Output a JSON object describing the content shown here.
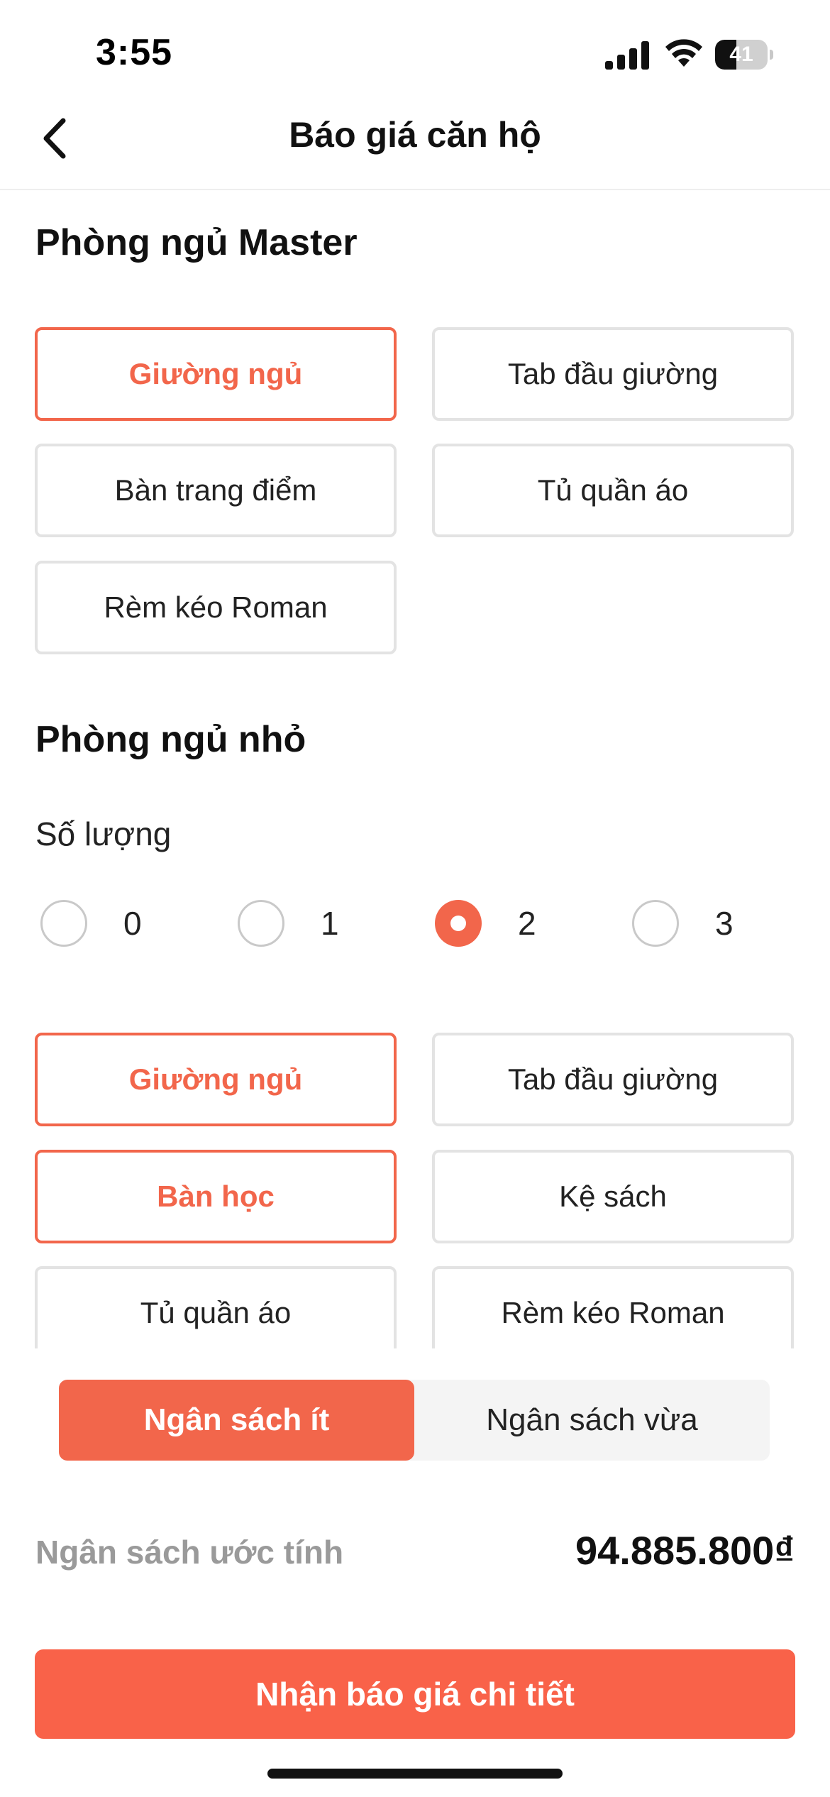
{
  "status_bar": {
    "time": "3:55",
    "battery": "41",
    "battery_level": 0.41
  },
  "header": {
    "title": "Báo giá căn hộ",
    "back_icon": "chevron-left-icon"
  },
  "master_bedroom": {
    "title": "Phòng ngủ Master",
    "items": [
      {
        "label": "Giường ngủ",
        "selected": true
      },
      {
        "label": "Tab đầu giường",
        "selected": false
      },
      {
        "label": "Bàn trang điểm",
        "selected": false
      },
      {
        "label": "Tủ quần áo",
        "selected": false
      },
      {
        "label": "Rèm kéo Roman",
        "selected": false
      }
    ]
  },
  "small_bedroom": {
    "title": "Phòng ngủ nhỏ",
    "quantity_label": "Số lượng",
    "quantity_options": [
      "0",
      "1",
      "2",
      "3"
    ],
    "quantity_selected": "2",
    "items": [
      {
        "label": "Giường ngủ",
        "selected": true
      },
      {
        "label": "Tab đầu giường",
        "selected": false
      },
      {
        "label": "Bàn học",
        "selected": true
      },
      {
        "label": "Kệ sách",
        "selected": false
      },
      {
        "label": "Tủ quần áo",
        "selected": false
      },
      {
        "label": "Rèm kéo Roman",
        "selected": false
      }
    ]
  },
  "budget": {
    "options": [
      {
        "label": "Ngân sách ít",
        "active": true
      },
      {
        "label": "Ngân sách vừa",
        "active": false
      }
    ],
    "estimate_label": "Ngân sách ước tính",
    "estimate_value": "94.885.800₫"
  },
  "cta": {
    "label": "Nhận báo giá chi tiết"
  },
  "colors": {
    "accent": "#f2664b",
    "cta": "#f96249",
    "muted": "#9a9a9a",
    "border": "#e3e3e3"
  }
}
